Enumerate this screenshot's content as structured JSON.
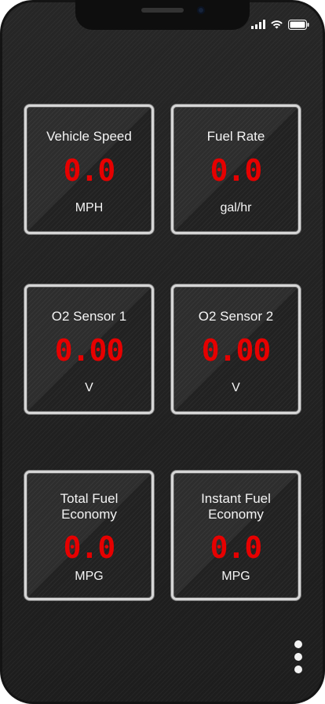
{
  "status_bar": {
    "signal_icon": "cellular-signal-icon",
    "wifi_icon": "wifi-icon",
    "battery_icon": "battery-icon"
  },
  "gauges": [
    {
      "title": "Vehicle Speed",
      "value": "0.0",
      "unit": "MPH"
    },
    {
      "title": "Fuel Rate",
      "value": "0.0",
      "unit": "gal/hr"
    },
    {
      "title": "O2 Sensor 1",
      "value": "0.00",
      "unit": "V"
    },
    {
      "title": "O2 Sensor 2",
      "value": "0.00",
      "unit": "V"
    },
    {
      "title_line1": "Total Fuel",
      "title_line2": "Economy",
      "value": "0.0",
      "unit": "MPG"
    },
    {
      "title_line1": "Instant Fuel",
      "title_line2": "Economy",
      "value": "0.0",
      "unit": "MPG"
    }
  ],
  "menu": {
    "icon": "more-vertical-icon"
  },
  "colors": {
    "background": "#202020",
    "tile_border": "#d6d6d6",
    "value_red": "#e60000",
    "text": "#f4f4f4"
  }
}
